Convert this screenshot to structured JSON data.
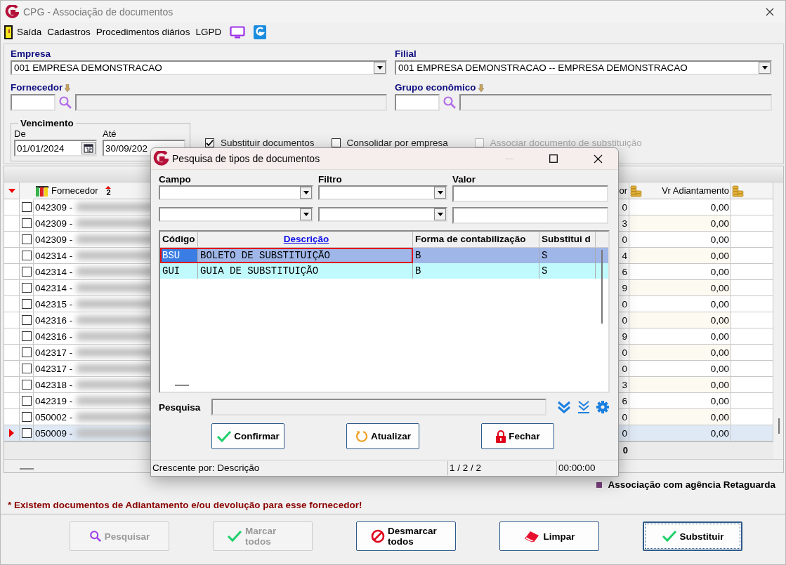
{
  "window": {
    "title": "CPG - Associação de documentos"
  },
  "menu": [
    {
      "kind": "exit",
      "label": "Saída"
    },
    {
      "kind": "text",
      "label": "Cadastros"
    },
    {
      "kind": "text",
      "label": "Procedimentos diários"
    },
    {
      "kind": "text",
      "label": "LGPD"
    },
    {
      "kind": "monitor"
    },
    {
      "kind": "logo"
    }
  ],
  "form": {
    "empresa": {
      "label": "Empresa",
      "value": "001 EMPRESA DEMONSTRACAO"
    },
    "filial": {
      "label": "Filial",
      "value": "001 EMPRESA DEMONSTRACAO -- EMPRESA DEMONSTRACAO"
    },
    "fornecedor": {
      "label": "Fornecedor"
    },
    "grupo": {
      "label": "Grupo econômico"
    },
    "vencimento": {
      "label": "Vencimento",
      "from_label": "De",
      "from": "01/01/2024",
      "to_label": "Até",
      "to": "30/09/202"
    },
    "options": [
      {
        "label": "Substituir documentos",
        "checked": true,
        "disabled": false
      },
      {
        "label": "Consolidar por empresa",
        "checked": false,
        "disabled": false
      },
      {
        "label": "Associar documento de substituição",
        "checked": false,
        "disabled": true
      }
    ]
  },
  "grid": {
    "columns": {
      "fornecedor": "Fornecedor",
      "sort_index": "2",
      "column_3": "or",
      "vr_adiantamento": "Vr Adiantamento"
    },
    "rows": [
      {
        "code": "042309 -",
        "column_3": "0",
        "vr_adiantamento": "0,00",
        "checked": false,
        "selected": false
      },
      {
        "code": "042309 -",
        "column_3": "3",
        "vr_adiantamento": "0,00",
        "checked": false,
        "selected": false
      },
      {
        "code": "042309 -",
        "column_3": "0",
        "vr_adiantamento": "0,00",
        "checked": false,
        "selected": false
      },
      {
        "code": "042314 -",
        "column_3": "4",
        "vr_adiantamento": "0,00",
        "checked": false,
        "selected": false
      },
      {
        "code": "042314 -",
        "column_3": "6",
        "vr_adiantamento": "0,00",
        "checked": false,
        "selected": false
      },
      {
        "code": "042314 -",
        "column_3": "9",
        "vr_adiantamento": "0,00",
        "checked": false,
        "selected": false
      },
      {
        "code": "042315 -",
        "column_3": "0",
        "vr_adiantamento": "0,00",
        "checked": false,
        "selected": false
      },
      {
        "code": "042316 -",
        "column_3": "0",
        "vr_adiantamento": "0,00",
        "checked": false,
        "selected": false
      },
      {
        "code": "042316 -",
        "column_3": "9",
        "vr_adiantamento": "0,00",
        "checked": false,
        "selected": false
      },
      {
        "code": "042317 -",
        "column_3": "0",
        "vr_adiantamento": "0,00",
        "checked": false,
        "selected": false
      },
      {
        "code": "042317 -",
        "column_3": "0",
        "vr_adiantamento": "0,00",
        "checked": false,
        "selected": false
      },
      {
        "code": "042318 -",
        "column_3": "3",
        "vr_adiantamento": "0,00",
        "checked": false,
        "selected": false
      },
      {
        "code": "042319 -",
        "column_3": "6",
        "vr_adiantamento": "0,00",
        "checked": false,
        "selected": false
      },
      {
        "code": "050002 -",
        "column_3": "0",
        "vr_adiantamento": "0,00",
        "checked": false,
        "selected": false
      },
      {
        "code": "050009 -",
        "column_3": "0",
        "vr_adiantamento": "0,00",
        "checked": false,
        "selected": true
      }
    ],
    "footer_column_3": "0"
  },
  "legend": {
    "label": "Associação com agência Retaguarda"
  },
  "warning": "* Existem documentos de Adiantamento e/ou devolução para esse fornecedor!",
  "buttons": [
    {
      "kind": "search",
      "label": "Pesquisar",
      "disabled": true,
      "focused": false
    },
    {
      "kind": "check",
      "label": "Marcar todos",
      "disabled": true,
      "focused": false
    },
    {
      "kind": "cancel",
      "label": "Desmarcar todos",
      "disabled": false,
      "focused": false
    },
    {
      "kind": "eraser",
      "label": "Limpar",
      "disabled": false,
      "focused": false
    },
    {
      "kind": "check",
      "label": "Substituir",
      "disabled": false,
      "focused": true
    }
  ],
  "dialog": {
    "title": "Pesquisa de tipos de documentos",
    "filter_labels": [
      "Campo",
      "Filtro",
      "Valor"
    ],
    "columns": [
      {
        "label": "Código",
        "sorted": false
      },
      {
        "label": "Descrição",
        "sorted": true
      },
      {
        "label": "Forma de contabilização",
        "sorted": false
      },
      {
        "label": "Substitui d",
        "sorted": false
      }
    ],
    "rows": [
      {
        "cells": [
          "BSU",
          "BOLETO DE SUBSTITUIÇÃO",
          "B",
          "S"
        ],
        "selected": true,
        "highlighted": true
      },
      {
        "cells": [
          "GUI",
          "GUIA DE SUBSTITUIÇÃO",
          "B",
          "S"
        ],
        "selected": false,
        "highlighted": false
      }
    ],
    "search_label": "Pesquisa",
    "buttons": [
      {
        "kind": "confirm",
        "label": "Confirmar"
      },
      {
        "kind": "refresh",
        "label": "Atualizar"
      },
      {
        "kind": "lock",
        "label": "Fechar"
      }
    ],
    "status": [
      "Crescente por: Descrição",
      "1 / 2 / 2",
      "00:00:00"
    ]
  }
}
